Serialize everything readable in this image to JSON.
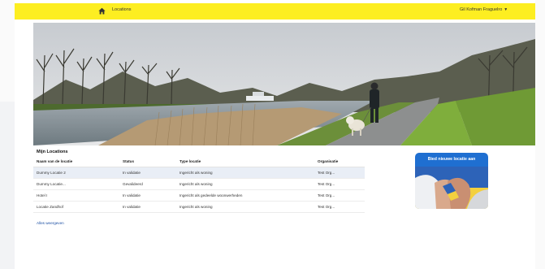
{
  "topbar": {
    "nav_label": "Locations",
    "user_label": "Gil Kofman Fraguelro",
    "color": "#fdee21"
  },
  "icons": {
    "home": "home-icon",
    "user_menu": "chevron-down-icon"
  },
  "main": {
    "section_title": "Mijn Locations",
    "table": {
      "headers": [
        "Naam van de locatie",
        "Status",
        "Type locatie",
        "Organisatie"
      ],
      "rows": [
        {
          "name": "Dummy Locatie 2",
          "status": "In validatie",
          "type": "Ingericht als woning",
          "org": "Test Org..."
        },
        {
          "name": "Dummy Locatie...",
          "status": "Gevalideerd",
          "type": "Ingericht als woning",
          "org": "Test Org..."
        },
        {
          "name": "Hotel I",
          "status": "In validatie",
          "type": "Ingericht als gedeelde woonwerheden",
          "org": "Test Org..."
        },
        {
          "name": "Locatie Zandhof",
          "status": "In validatie",
          "type": "Ingericht als woning",
          "org": "Test Org..."
        }
      ]
    },
    "show_all": "Alles weergeven"
  },
  "promo": {
    "title": "Bied nieuwe locatie aan",
    "color": "#1f6fd1"
  }
}
